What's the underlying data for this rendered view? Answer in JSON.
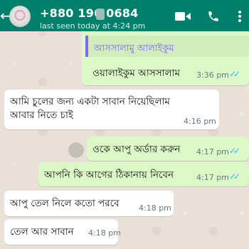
{
  "header": {
    "contact_name": "+880 196 0684",
    "last_seen": "last seen today at 4:24 pm"
  },
  "messages": [
    {
      "direction": "out",
      "quoted": "আসসালামু আলাইকুম",
      "text": "ওয়ালাইকুম আসসালাম",
      "time": "3:36 pm",
      "status": "read"
    },
    {
      "direction": "in",
      "lines": [
        "আমি চুলের জন্য একটা সাবান নিয়েছিলাম",
        "আবার নিতে চাই"
      ],
      "time": "4:16 pm"
    },
    {
      "direction": "out",
      "text": "ওকে আপু অর্ডার করুন",
      "time": "4:17 pm",
      "status": "read"
    },
    {
      "direction": "out",
      "text": "আপনি কি আগের ঠিকানায় নিবেন",
      "time": "4:17 pm",
      "status": "read"
    },
    {
      "direction": "in",
      "text": "আপু তেল নিলে কতো পরবে",
      "time": "4:18 pm"
    },
    {
      "direction": "in",
      "text": "তেল আর সাবান",
      "time": "4:18 pm"
    }
  ],
  "icons": {
    "back": "back-arrow-icon",
    "video": "video-call-icon",
    "phone": "voice-call-icon",
    "menu": "more-vertical-icon",
    "tick": "double-check-icon"
  },
  "colors": {
    "header": "#00806a",
    "outgoing_bubble": "#dcf8c6",
    "incoming_bubble": "#ffffff",
    "read_ticks": "#34b7f1",
    "quote_accent": "#7f66ff"
  }
}
